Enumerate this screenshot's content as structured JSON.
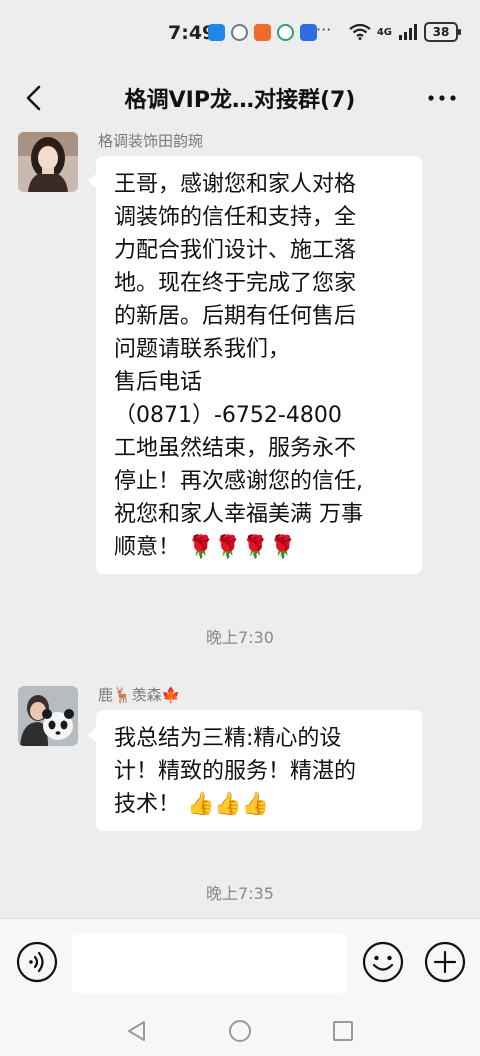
{
  "status_bar": {
    "time": "7:49",
    "more": "···",
    "network": "4G",
    "battery": "38",
    "app_icons": [
      {
        "name": "blue-chat-app-icon",
        "color": "#1e88e5"
      },
      {
        "name": "cloud-app-icon",
        "color": "#6d7b8a"
      },
      {
        "name": "orange-app-icon",
        "color": "#f06a2c"
      },
      {
        "name": "green-app-icon",
        "color": "#2aa56a"
      },
      {
        "name": "blue-browser-app-icon",
        "color": "#2f6de1"
      }
    ]
  },
  "header": {
    "title": "格调VIP龙…对接群(7)"
  },
  "messages": [
    {
      "sender": "格调装饰田韵琬",
      "lines": [
        "王哥，感谢您和家人对格",
        "调装饰的信任和支持，全",
        "力配合我们设计、施工落",
        "地。现在终于完成了您家",
        "的新居。后期有任何售后",
        "问题请联系我们，",
        "售后电话",
        "（0871）-6752-4800",
        "工地虽然结束，服务永不",
        "停止！再次感谢您的信任,",
        "祝您和家人幸福美满 万事",
        "顺意！ 🌹🌹🌹🌹"
      ]
    },
    {
      "sender": "鹿🦌羡森🍁",
      "lines": [
        "我总结为三精:精心的设",
        "计！精致的服务！精湛的",
        "技术！ 👍👍👍"
      ]
    }
  ],
  "timestamps": [
    "晚上7:30",
    "晚上7:35"
  ],
  "input": {
    "placeholder": ""
  },
  "colors": {
    "background": "#ededed",
    "bubble": "#ffffff",
    "timestamp": "#8a8a8a"
  }
}
